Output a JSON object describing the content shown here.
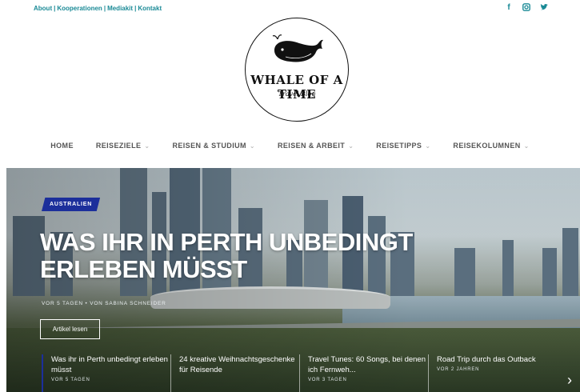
{
  "top_links": [
    {
      "label": "About"
    },
    {
      "label": "Kooperationen"
    },
    {
      "label": "Mediakit"
    },
    {
      "label": "Kontakt"
    }
  ],
  "social_icons": [
    "facebook-icon",
    "instagram-icon",
    "twitter-icon"
  ],
  "logo": {
    "title": "WHALE OF A TIME",
    "subtitle": "Travel Blog"
  },
  "nav": [
    {
      "label": "HOME",
      "dropdown": false
    },
    {
      "label": "REISEZIELE",
      "dropdown": true
    },
    {
      "label": "REISEN & STUDIUM",
      "dropdown": true
    },
    {
      "label": "REISEN & ARBEIT",
      "dropdown": true
    },
    {
      "label": "REISETIPPS",
      "dropdown": true
    },
    {
      "label": "REISEKOLUMNEN",
      "dropdown": true
    }
  ],
  "hero": {
    "category": "AUSTRALIEN",
    "title": "WAS IHR IN PERTH UNBEDINGT ERLEBEN MÜSST",
    "meta": "VOR 5 TAGEN  •  VON SABINA SCHNEIDER",
    "button": "Artikel lesen"
  },
  "cards": [
    {
      "title": "Was ihr in Perth unbedingt erleben müsst",
      "date": "VOR 5 TAGEN"
    },
    {
      "title": "24 kreative Weihnachtsgeschenke für Reisende",
      "date": ""
    },
    {
      "title": "Travel Tunes: 60 Songs, bei denen ich Fernweh...",
      "date": "VOR 3 TAGEN"
    },
    {
      "title": "Road Trip durch das Outback",
      "date": "VOR 2 JAHREN"
    }
  ],
  "colors": {
    "accent": "#1a8a96",
    "badge": "#1c2f9b"
  }
}
